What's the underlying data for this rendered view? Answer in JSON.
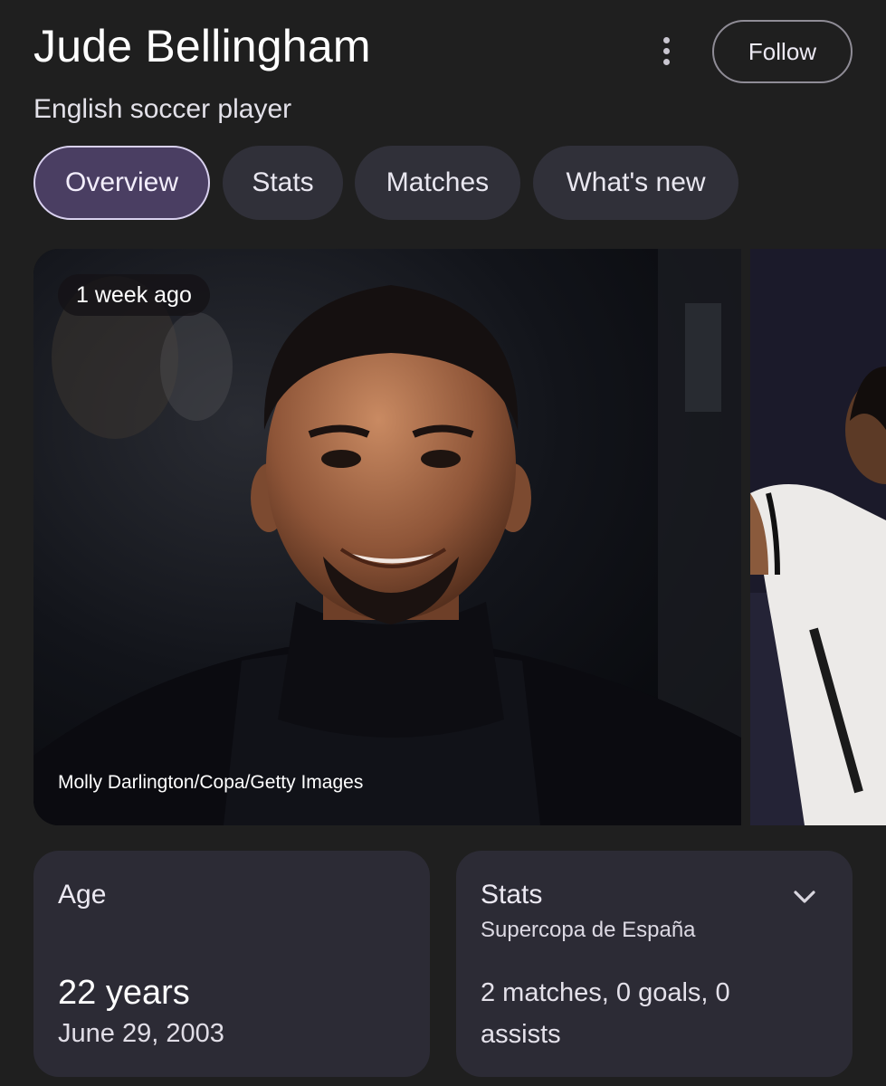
{
  "header": {
    "title": "Jude Bellingham",
    "subtitle": "English soccer player",
    "follow_label": "Follow",
    "more_icon": "more-vert-icon"
  },
  "tabs": [
    {
      "label": "Overview",
      "active": true
    },
    {
      "label": "Stats",
      "active": false
    },
    {
      "label": "Matches",
      "active": false
    },
    {
      "label": "What's new",
      "active": false
    }
  ],
  "carousel": {
    "items": [
      {
        "badge": "1 week ago",
        "credit": "Molly Darlington/Copa/Getty Images"
      }
    ]
  },
  "age_card": {
    "label": "Age",
    "value": "22 years",
    "birthdate": "June 29, 2003"
  },
  "stats_card": {
    "label": "Stats",
    "competition": "Supercopa de España",
    "summary": "2 matches, 0 goals, 0 assists",
    "expand_icon": "chevron-down-icon"
  },
  "colors": {
    "background": "#1f1f1f",
    "chip": "#303039",
    "chip_active": "#4a3e62",
    "card": "#2c2b35"
  }
}
